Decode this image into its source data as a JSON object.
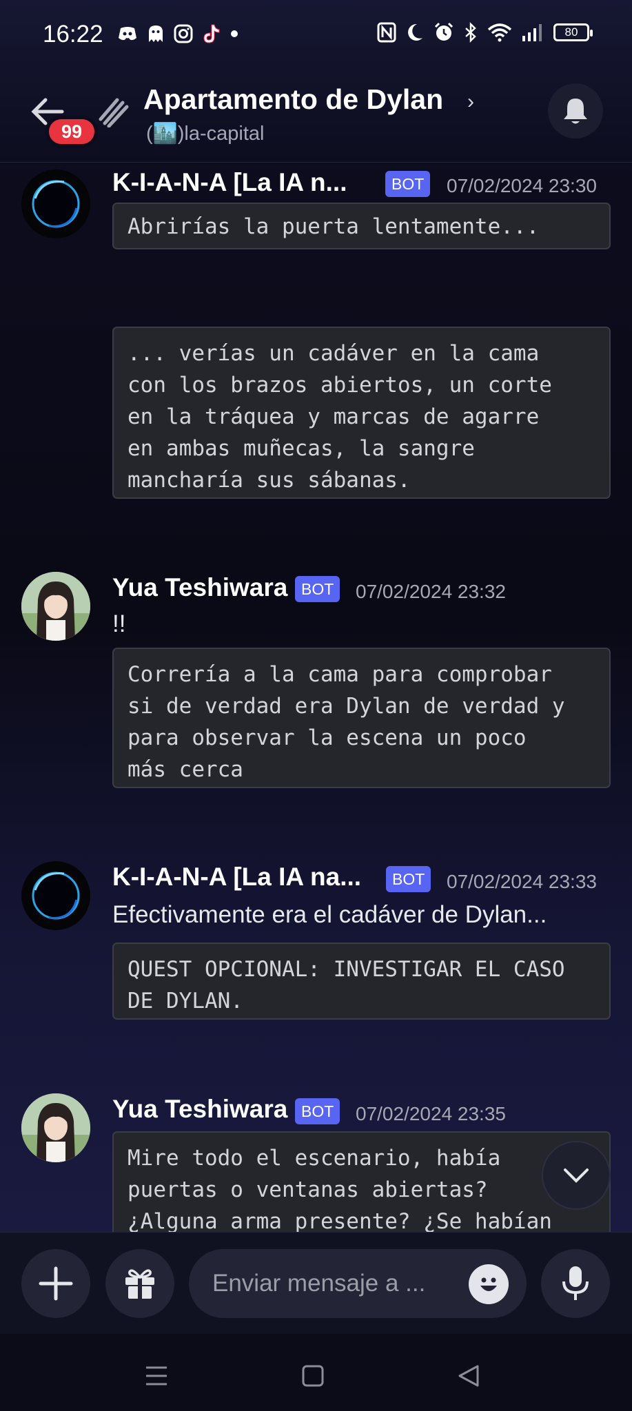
{
  "status_bar": {
    "time": "16:22",
    "app_icons": [
      "discord-icon",
      "ghost-icon",
      "instagram-icon",
      "tiktok-icon",
      "dot-icon"
    ],
    "system_icons": [
      "nfc-icon",
      "moon-icon",
      "alarm-icon",
      "bluetooth-icon",
      "wifi-icon",
      "signal-icon"
    ],
    "battery": "80"
  },
  "header": {
    "title": "Apartamento de Dylan",
    "channel": "(🏙️)la-capital",
    "unread_badge": "99"
  },
  "messages": [
    {
      "author": "K-I-A-N-A [La IA n...",
      "bot_label": "BOT",
      "timestamp": "07/02/2024 23:30",
      "code_blocks": [
        "Abrirías la puerta lentamente...",
        "... verías un cadáver en la cama\ncon los brazos abiertos, un corte\nen la tráquea y marcas de agarre\nen ambas muñecas, la sangre\nmancharía sus sábanas."
      ]
    },
    {
      "author": "Yua Teshiwara",
      "bot_label": "BOT",
      "timestamp": "07/02/2024 23:32",
      "text": "!!",
      "code_blocks": [
        "Correría a la cama para comprobar\nsi de verdad era Dylan de verdad y\npara observar la escena un poco\nmás cerca"
      ]
    },
    {
      "author": "K-I-A-N-A [La IA na...",
      "bot_label": "BOT",
      "timestamp": "07/02/2024 23:33",
      "text": "Efectivamente era el cadáver de Dylan...",
      "code_blocks": [
        "QUEST OPCIONAL: INVESTIGAR EL CASO\nDE DYLAN."
      ]
    },
    {
      "author": "Yua Teshiwara",
      "bot_label": "BOT",
      "timestamp": "07/02/2024 23:35",
      "code_blocks": [
        "Mire todo el escenario, había\npuertas o ventanas abiertas?\n¿Alguna arma presente? ¿Se habían"
      ]
    }
  ],
  "composer": {
    "placeholder": "Enviar mensaje a ..."
  },
  "colors": {
    "bot_tag": "#5865f2",
    "badge": "#e8343e",
    "code_bg": "#25262c"
  }
}
